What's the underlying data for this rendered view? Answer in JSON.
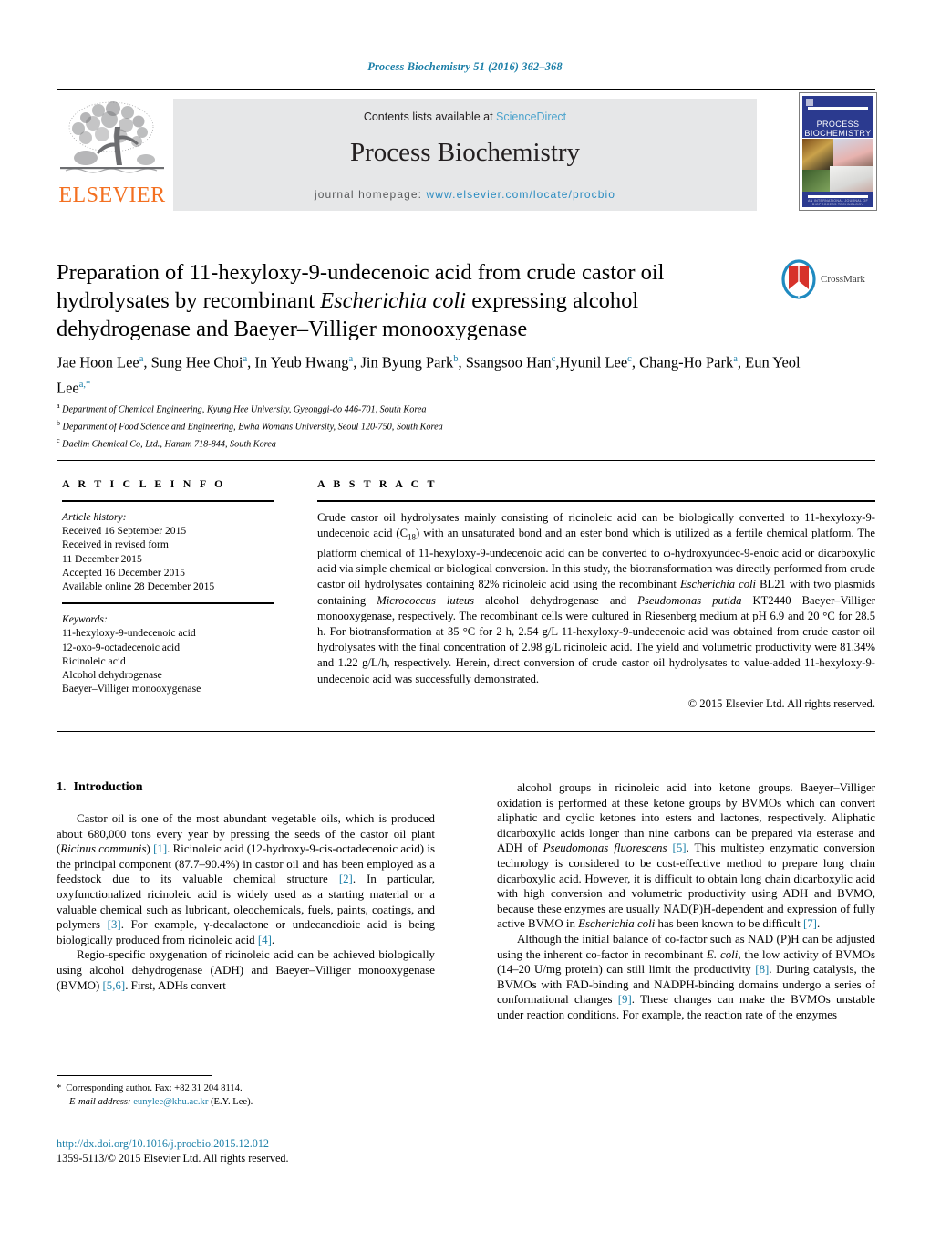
{
  "running_head": "Process Biochemistry 51 (2016) 362–368",
  "masthead": {
    "publisher_name": "ELSEVIER",
    "contents_prefix": "Contents lists available at ",
    "contents_link": "ScienceDirect",
    "journal_title": "Process Biochemistry",
    "homepage_prefix": "journal homepage: ",
    "homepage_url": "www.elsevier.com/locate/procbio",
    "cover": {
      "title_line1": "PROCESS",
      "title_line2": "BIOCHEMISTRY",
      "caption": "AN INTERNATIONAL JOURNAL OF BIOPROCESS TECHNOLOGY"
    }
  },
  "article": {
    "title_line1": "Preparation of 11-hexyloxy-9-undecenoic acid from crude castor oil",
    "title_line2_a": "hydrolysates by recombinant ",
    "title_line2_italic": "Escherichia coli",
    "title_line2_b": " expressing alcohol",
    "title_line3": "dehydrogenase and Baeyer–Villiger monooxygenase",
    "crossmark_label": "CrossMark",
    "authors": [
      {
        "name": "Jae Hoon Lee",
        "mark": "a",
        "sep": ", "
      },
      {
        "name": "Sung Hee Choi",
        "mark": "a",
        "sep": ", "
      },
      {
        "name": "In Yeub Hwang",
        "mark": "a",
        "sep": ", "
      },
      {
        "name": "Jin Byung Park",
        "mark": "b",
        "sep": ", "
      },
      {
        "name": "Ssangsoo Han",
        "mark": "c",
        "sep": ","
      },
      {
        "name": "Hyunil Lee",
        "mark": "c",
        "sep": ", "
      },
      {
        "name": "Chang-Ho Park",
        "mark": "a",
        "sep": ", "
      },
      {
        "name": "Eun Yeol Lee",
        "mark": "a,*",
        "sep": ""
      }
    ],
    "affiliations": [
      {
        "mark": "a",
        "text": "Department of Chemical Engineering, Kyung Hee University, Gyeonggi-do 446-701, South Korea"
      },
      {
        "mark": "b",
        "text": "Department of Food Science and Engineering, Ewha Womans University, Seoul 120-750, South Korea"
      },
      {
        "mark": "c",
        "text": "Daelim Chemical Co, Ltd., Hanam 718-844, South Korea"
      }
    ]
  },
  "article_info": {
    "heading": "A R T I C L E    I N F O",
    "history_label": "Article history:",
    "history": [
      "Received 16 September 2015",
      "Received in revised form",
      "11 December 2015",
      "Accepted 16 December 2015",
      "Available online 28 December 2015"
    ],
    "keywords_label": "Keywords:",
    "keywords": [
      "11-hexyloxy-9-undecenoic acid",
      "12-oxo-9-octadecenoic acid",
      "Ricinoleic acid",
      "Alcohol dehydrogenase",
      "Baeyer–Villiger monooxygenase"
    ]
  },
  "abstract": {
    "heading": "A B S T R A C T",
    "paragraph_parts": [
      {
        "t": "Crude castor oil hydrolysates mainly consisting of ricinoleic acid can be biologically converted to 11-hexyloxy-9-undecenoic acid (C",
        "style": "normal"
      },
      {
        "t": "18",
        "style": "sub"
      },
      {
        "t": ") with an unsaturated bond and an ester bond which is utilized as a fertile chemical platform. The platform chemical of 11-hexyloxy-9-undecenoic acid can be converted to ω-hydroxyundec-9-enoic acid or dicarboxylic acid via simple chemical or biological conversion. In this study, the biotransformation was directly performed from crude castor oil hydrolysates containing 82% ricinoleic acid using the recombinant ",
        "style": "normal"
      },
      {
        "t": "Escherichia coli",
        "style": "italic"
      },
      {
        "t": " BL21 with two plasmids containing ",
        "style": "normal"
      },
      {
        "t": "Micrococcus luteus",
        "style": "italic"
      },
      {
        "t": " alcohol dehydrogenase and ",
        "style": "normal"
      },
      {
        "t": "Pseudomonas putida",
        "style": "italic"
      },
      {
        "t": " KT2440 Baeyer–Villiger monooxygenase, respectively. The recombinant cells were cultured in Riesenberg medium at pH 6.9 and 20 °C for 28.5 h. For biotransformation at 35 °C for 2 h, 2.54 g/L 11-hexyloxy-9-undecenoic acid was obtained from crude castor oil hydrolysates with the final concentration of 2.98 g/L ricinoleic acid. The yield and volumetric productivity were 81.34% and 1.22 g/L/h, respectively. Herein, direct conversion of crude castor oil hydrolysates to value-added 11-hexyloxy-9-undecenoic acid was successfully demonstrated.",
        "style": "normal"
      }
    ],
    "copyright": "© 2015 Elsevier Ltd. All rights reserved."
  },
  "introduction": {
    "number": "1.",
    "title": "Introduction",
    "left_paragraphs": [
      [
        {
          "t": "Castor oil is one of the most abundant vegetable oils, which is produced about 680,000 tons every year by pressing the seeds of the castor oil plant (",
          "style": "normal"
        },
        {
          "t": "Ricinus communis",
          "style": "italic"
        },
        {
          "t": ") ",
          "style": "normal"
        },
        {
          "t": "[1]",
          "style": "ref"
        },
        {
          "t": ". Ricinoleic acid (12-hydroxy-9-cis-octadecenoic acid) is the principal component (87.7–90.4%) in castor oil and has been employed as a feedstock due to its valuable chemical structure ",
          "style": "normal"
        },
        {
          "t": "[2]",
          "style": "ref"
        },
        {
          "t": ". In particular, oxyfunctionalized ricinoleic acid is widely used as a starting material or a valuable chemical such as lubricant, oleochemicals, fuels, paints, coatings, and polymers ",
          "style": "normal"
        },
        {
          "t": "[3]",
          "style": "ref"
        },
        {
          "t": ". For example, γ-decalactone or undecanedioic acid is being biologically produced from ricinoleic acid ",
          "style": "normal"
        },
        {
          "t": "[4]",
          "style": "ref"
        },
        {
          "t": ".",
          "style": "normal"
        }
      ],
      [
        {
          "t": "Regio-specific oxygenation of ricinoleic acid can be achieved biologically using alcohol dehydrogenase (ADH) and Baeyer–Villiger monooxygenase (BVMO) ",
          "style": "normal"
        },
        {
          "t": "[5,6]",
          "style": "ref"
        },
        {
          "t": ". First, ADHs convert",
          "style": "normal"
        }
      ]
    ],
    "right_paragraphs": [
      [
        {
          "t": "alcohol groups in ricinoleic acid into ketone groups. Baeyer–Villiger oxidation is performed at these ketone groups by BVMOs which can convert aliphatic and cyclic ketones into esters and lactones, respectively. Aliphatic dicarboxylic acids longer than nine carbons can be prepared via esterase and ADH of ",
          "style": "normal"
        },
        {
          "t": "Pseudomonas fluorescens",
          "style": "italic"
        },
        {
          "t": " ",
          "style": "normal"
        },
        {
          "t": "[5]",
          "style": "ref"
        },
        {
          "t": ". This multistep enzymatic conversion technology is considered to be cost-effective method to prepare long chain dicarboxylic acid. However, it is difficult to obtain long chain dicarboxylic acid with high conversion and volumetric productivity using ADH and BVMO, because these enzymes are usually NAD(P)H-dependent and expression of fully active BVMO in ",
          "style": "normal"
        },
        {
          "t": "Escherichia coli",
          "style": "italic"
        },
        {
          "t": " has been known to be difficult ",
          "style": "normal"
        },
        {
          "t": "[7]",
          "style": "ref"
        },
        {
          "t": ".",
          "style": "normal"
        }
      ],
      [
        {
          "t": "Although the initial balance of co-factor such as NAD (P)H can be adjusted using the inherent co-factor in recombinant ",
          "style": "normal"
        },
        {
          "t": "E. coli",
          "style": "italic"
        },
        {
          "t": ", the low activity of BVMOs (14–20 U/mg protein) can still limit the productivity ",
          "style": "normal"
        },
        {
          "t": "[8]",
          "style": "ref"
        },
        {
          "t": ". During catalysis, the BVMOs with FAD-binding and NADPH-binding domains undergo a series of conformational changes ",
          "style": "normal"
        },
        {
          "t": "[9]",
          "style": "ref"
        },
        {
          "t": ". These changes can make the BVMOs unstable under reaction conditions. For example, the reaction rate of the enzymes",
          "style": "normal"
        }
      ]
    ]
  },
  "footnote": {
    "star": "*",
    "corresponding": "Corresponding author. Fax: +82 31 204 8114.",
    "email_label": "E-mail address:",
    "email": "eunylee@khu.ac.kr",
    "email_suffix": " (E.Y. Lee)."
  },
  "footer": {
    "doi": "http://dx.doi.org/10.1016/j.procbio.2015.12.012",
    "issn_line": "1359-5113/© 2015 Elsevier Ltd. All rights reserved."
  },
  "colors": {
    "link_blue": "#1b7fa8",
    "sciencedirect_blue": "#4ba3cd",
    "elsevier_orange": "#F37021",
    "band_gray": "#e6e7e8"
  }
}
